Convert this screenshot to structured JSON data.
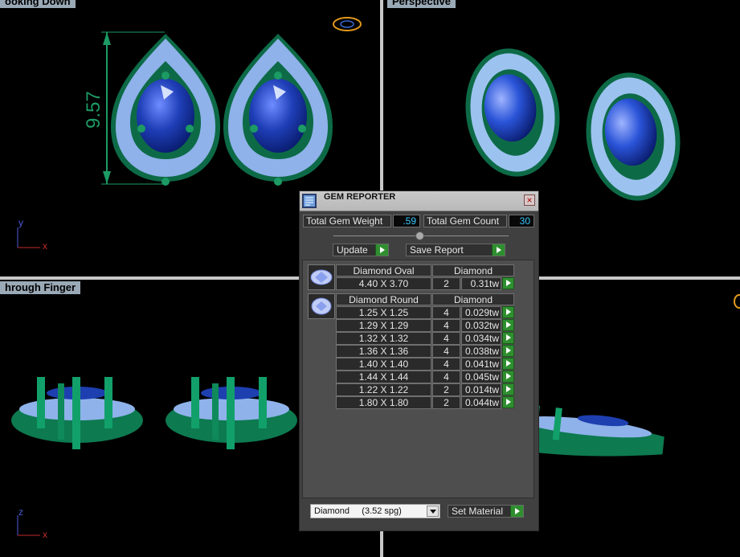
{
  "viewports": {
    "top_left": {
      "label": "ooking Down",
      "dimension": "9.57",
      "axis_up": "y",
      "axis_right": "x"
    },
    "top_right": {
      "label": "Perspective"
    },
    "bottom_left": {
      "label": "hrough Finger",
      "axis_up": "z",
      "axis_right": "x"
    }
  },
  "gem_reporter": {
    "title": "GEM REPORTER",
    "total_gem_weight_label": "Total Gem Weight",
    "total_gem_weight_value": ".59",
    "total_gem_count_label": "Total Gem Count",
    "total_gem_count_value": "30",
    "update_label": "Update",
    "save_report_label": "Save Report",
    "groups": [
      {
        "name": "Diamond Oval",
        "material": "Diamond",
        "rows": [
          {
            "size": "4.40 X 3.70",
            "count": "2",
            "weight": "0.31tw"
          }
        ]
      },
      {
        "name": "Diamond Round",
        "material": "Diamond",
        "rows": [
          {
            "size": "1.25 X 1.25",
            "count": "4",
            "weight": "0.029tw"
          },
          {
            "size": "1.29 X 1.29",
            "count": "4",
            "weight": "0.032tw"
          },
          {
            "size": "1.32 X 1.32",
            "count": "4",
            "weight": "0.034tw"
          },
          {
            "size": "1.36 X 1.36",
            "count": "4",
            "weight": "0.038tw"
          },
          {
            "size": "1.40 X 1.40",
            "count": "4",
            "weight": "0.041tw"
          },
          {
            "size": "1.44 X 1.44",
            "count": "4",
            "weight": "0.045tw"
          },
          {
            "size": "1.22 X 1.22",
            "count": "2",
            "weight": "0.014tw"
          },
          {
            "size": "1.80 X 1.80",
            "count": "2",
            "weight": "0.044tw"
          }
        ]
      }
    ],
    "material_select": "Diamond     (3.52 spg)",
    "set_material_label": "Set Material"
  },
  "colors": {
    "metal": "#0f8a5a",
    "sapphire": "#1d3fb0",
    "diamond": "#a8c8f0",
    "value_text": "#36c8ff",
    "go_green": "#2f8f2f"
  }
}
